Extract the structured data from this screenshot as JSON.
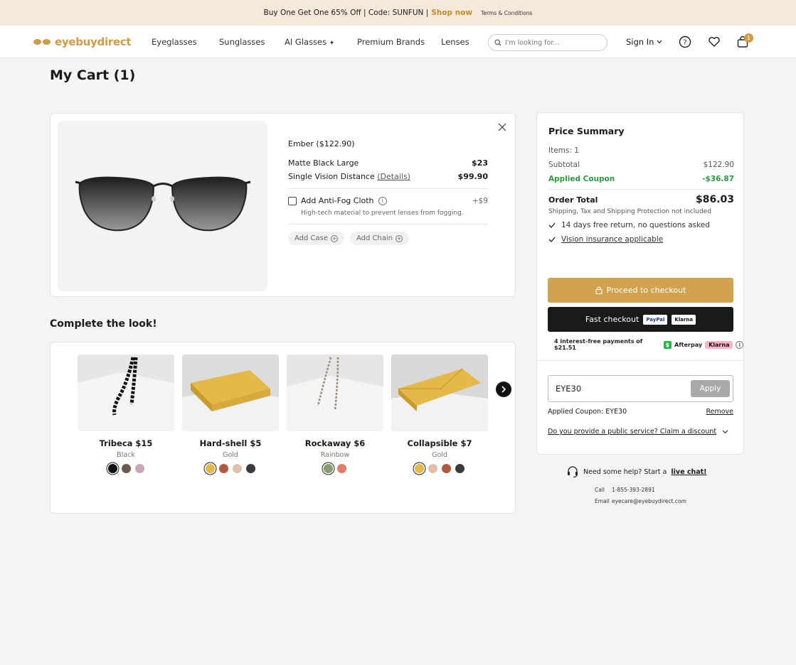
{
  "promo": {
    "text": "Buy One Get One 65% Off | Code: SUNFUN |",
    "link": "Shop now",
    "terms": "Terms & Conditions"
  },
  "nav": {
    "logo": "eyebuydirect",
    "items": [
      "Eyeglasses",
      "Sunglasses",
      "AI Glasses",
      "Premium Brands",
      "Lenses"
    ],
    "search_placeholder": "I'm looking for...",
    "signin": "Sign In",
    "cart_count": "1"
  },
  "page_title": "My Cart (1)",
  "cart_item": {
    "name": "Ember ($122.90)",
    "lines": [
      {
        "label": "Matte Black Large",
        "price": "$23"
      },
      {
        "label": "Single Vision Distance",
        "link": "(Details)",
        "price": "$99.90"
      }
    ],
    "addon": {
      "label": "Add Anti-Fog Cloth",
      "price": "+$9",
      "desc": "High-tech material to prevent lenses from fogging."
    },
    "pills": [
      "Add Case",
      "Add Chain"
    ]
  },
  "complete_look": {
    "title": "Complete the look!",
    "products": [
      {
        "name": "Tribeca $15",
        "color": "Black",
        "swatches": [
          "#111111",
          "#6b5a4a",
          "#c9a5b5"
        ]
      },
      {
        "name": "Hard-shell $5",
        "color": "Gold",
        "swatches": [
          "#e5b84a",
          "#b2583f",
          "#e3bfaa",
          "#3a3a3a"
        ]
      },
      {
        "name": "Rockaway $6",
        "color": "Rainbow",
        "swatches": [
          "#8a9c6a",
          "#e47c6a"
        ]
      },
      {
        "name": "Collapsible $7",
        "color": "Gold",
        "swatches": [
          "#e5b84a",
          "#e3bfaa",
          "#b2583f",
          "#3a3a3a"
        ]
      }
    ]
  },
  "summary": {
    "title": "Price Summary",
    "items": "Items: 1",
    "subtotal_label": "Subtotal",
    "subtotal": "$122.90",
    "coupon_label": "Applied Coupon",
    "coupon_value": "-$36.87",
    "total_label": "Order Total",
    "total": "$86.03",
    "ship_note": "Shipping, Tax and Shipping Protection not included",
    "checks": [
      "14 days free return, no questions asked",
      "Vision insurance applicable"
    ],
    "checkout_btn": "Proceed to checkout",
    "fast_btn": "Fast checkout",
    "paypal": "PayPal",
    "klarna": "Klarna",
    "afterpay_text": "4 interest-free payments of $21.51",
    "afterpay": "Afterpay",
    "coupon_code": "EYE30",
    "apply": "Apply",
    "applied_coupon": "Applied Coupon: EYE30",
    "remove": "Remove",
    "discount_link": "Do you provide a public service? Claim a discount"
  },
  "help": {
    "text": "Need some help? Start a",
    "chat": "live chat!",
    "call_label": "Call",
    "phone": "1-855-393-2891",
    "email_label": "Email",
    "email": "eyecare@eyebuydirect.com"
  },
  "colors": {
    "accent": "#d1a350",
    "green": "#2a9d3a",
    "promo_bg": "#f7e9da"
  }
}
